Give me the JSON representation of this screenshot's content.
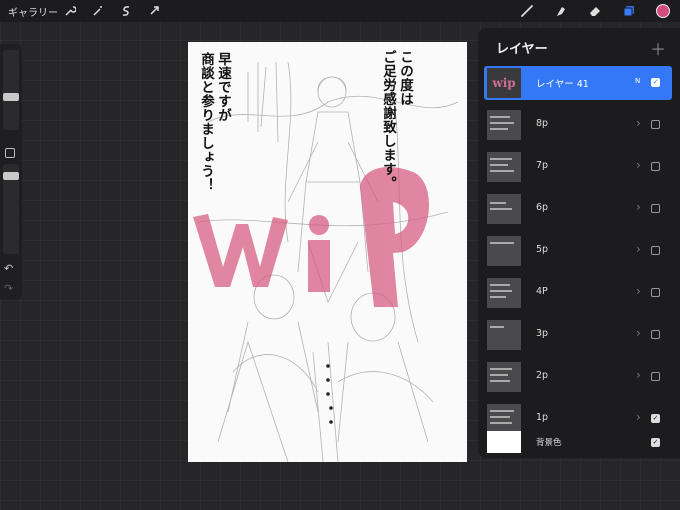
{
  "toolbar": {
    "gallery_label": "ギャラリー",
    "actions": [
      "wrench-icon",
      "magic-wand-icon",
      "selection-icon",
      "transform-icon"
    ],
    "tools": [
      "brush-icon",
      "smudge-icon",
      "eraser-icon",
      "layers-icon"
    ],
    "current_color": "#d44d7d"
  },
  "sidebar": {
    "brush_size_level": 0.5,
    "opacity_level": 0.5
  },
  "canvas": {
    "text_right": [
      "この度は",
      "ご足労感謝致します。"
    ],
    "text_left": [
      "早速ですが",
      "商談と参りましょう！"
    ],
    "stamp_text": "wip",
    "stamp_color": "#d6577f"
  },
  "layers_panel": {
    "title": "レイヤー",
    "layers": [
      {
        "name": "レイヤー 41",
        "mode": "N",
        "visible": true,
        "active": true
      },
      {
        "name": "8p",
        "visible": false
      },
      {
        "name": "7p",
        "visible": false
      },
      {
        "name": "6p",
        "visible": false
      },
      {
        "name": "5p",
        "visible": false
      },
      {
        "name": "4P",
        "visible": false
      },
      {
        "name": "3p",
        "visible": false
      },
      {
        "name": "2p",
        "visible": false
      },
      {
        "name": "1p",
        "visible": true
      },
      {
        "name": "背景色",
        "visible": true
      }
    ]
  }
}
